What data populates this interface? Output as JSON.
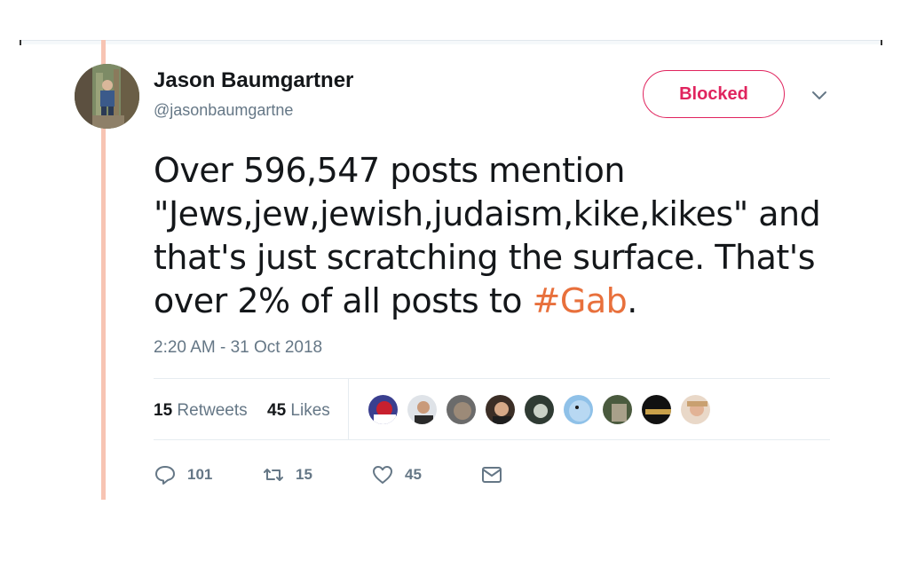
{
  "author": {
    "name": "Jason Baumgartner",
    "handle": "@jasonbaumgartne",
    "avatar_icon": "profile-photo-icon"
  },
  "follow_button": {
    "label": "Blocked",
    "color": "#e0245e"
  },
  "tweet": {
    "text_main": "Over 596,547 posts mention \"Jews,jew,jewish,judaism,kike,kikes\" and that's just scratching the surface. That's over 2% of all posts to ",
    "hashtag": "#Gab",
    "text_end": ".",
    "hashtag_color": "#e8703c",
    "timestamp": "2:20 AM - 31 Oct 2018"
  },
  "stats": {
    "retweets_count": "15",
    "retweets_label": "Retweets",
    "likes_count": "45",
    "likes_label": "Likes",
    "liker_avatar_count": 9
  },
  "actions": {
    "reply_count": "101",
    "retweet_count": "15",
    "like_count": "45"
  },
  "colors": {
    "thread_line": "#f7c4b3",
    "muted_text": "#657786"
  }
}
